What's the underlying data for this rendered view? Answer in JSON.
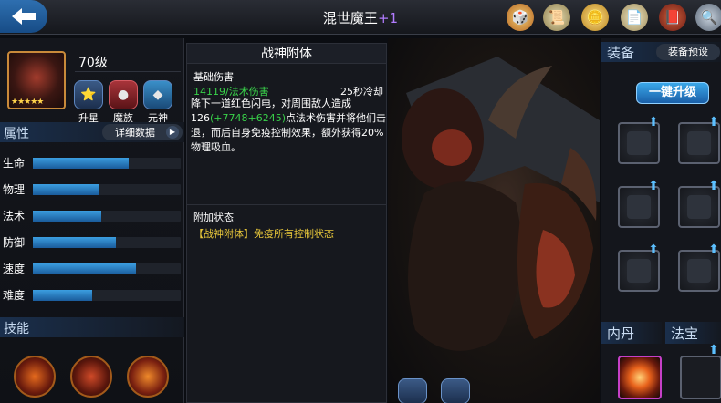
{
  "header": {
    "title": "混世魔王",
    "title_suffix": "+1",
    "icons": [
      "dice-icon",
      "scroll-icon",
      "coin-icon",
      "document-icon",
      "book-icon",
      "search-icon"
    ]
  },
  "hero": {
    "level": "70级",
    "stars": "★★★★★",
    "buttons": [
      {
        "label": "升星",
        "icon": "star-upgrade-icon"
      },
      {
        "label": "魔族",
        "icon": "demon-race-icon"
      },
      {
        "label": "元神",
        "icon": "spirit-icon"
      }
    ]
  },
  "attributes": {
    "title": "属性",
    "detail_button": "详细数据",
    "stats": [
      {
        "label": "生命",
        "fill": 0.65
      },
      {
        "label": "物理",
        "fill": 0.45
      },
      {
        "label": "法术",
        "fill": 0.46
      },
      {
        "label": "防御",
        "fill": 0.56
      },
      {
        "label": "速度",
        "fill": 0.7
      },
      {
        "label": "难度",
        "fill": 0.4
      }
    ]
  },
  "skills": {
    "title": "技能",
    "icons": [
      "fire-skill-icon",
      "rage-skill-icon",
      "flame-mask-skill-icon"
    ]
  },
  "skill_detail": {
    "title": "战神附体",
    "subtitle": "基础伤害",
    "damage": "14119/法术伤害",
    "cooldown": "25秒冷却",
    "desc_part1": "降下一道红色闪电，对周围敌人造成126",
    "desc_bonus": "(+7748+6245)",
    "desc_part2": "点法术伤害并将他们击退，而后自身免疫控制效果，额外获得20%物理吸血。",
    "extra_title": "附加状态",
    "extra_text": "【战神附体】免疫所有控制状态"
  },
  "equipment": {
    "title": "装备",
    "preset_button": "装备预设",
    "upgrade_button": "一键升级"
  },
  "bottom": {
    "inner_dan": "内丹",
    "treasure": "法宝"
  },
  "colors": {
    "accent_blue": "#2e8fd6",
    "bonus_green": "#39d24a",
    "status_yellow": "#e7c63a",
    "title_purple": "#b27cff"
  }
}
